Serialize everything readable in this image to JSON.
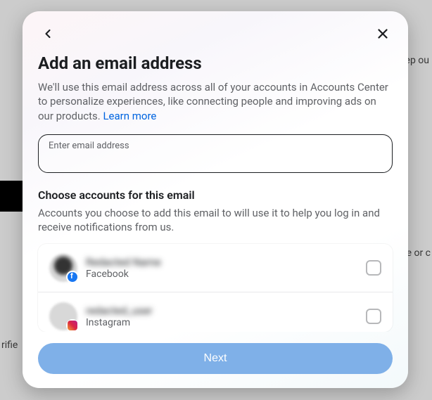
{
  "backdrop": {
    "snippet_right_top": "ep ou",
    "snippet_right_mid": "e or c",
    "snippet_left_bottom": "rifie"
  },
  "modal": {
    "title": "Add an email address",
    "subtitle_part1": "We'll use this email address across all of your accounts in Accounts Center to personalize experiences, like connecting people and improving ads on our products. ",
    "learn_more": "Learn more",
    "email_label": "Enter email address",
    "email_value": "",
    "choose_title": "Choose accounts for this email",
    "choose_sub": "Accounts you choose to add this email to will use it to help you log in and receive notifications from us.",
    "accounts": [
      {
        "name": "Redacted Name",
        "platform": "Facebook"
      },
      {
        "name": "redacted_user",
        "platform": "Instagram"
      }
    ],
    "next_label": "Next"
  }
}
